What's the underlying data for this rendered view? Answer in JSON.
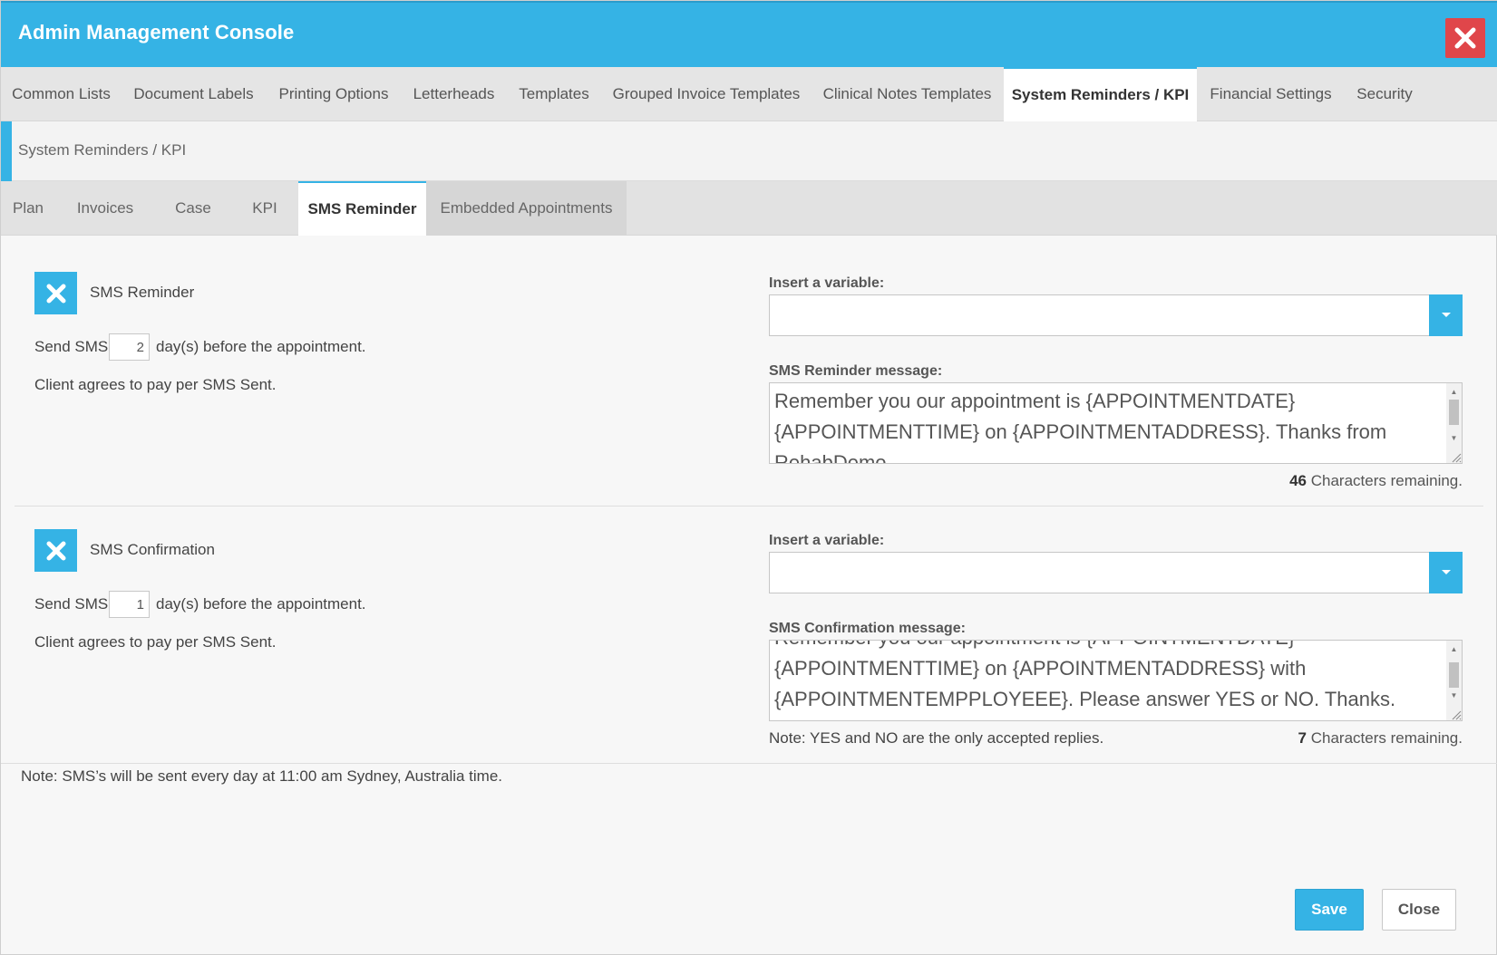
{
  "window": {
    "title": "Admin Management Console",
    "accent_color": "#35b3e5",
    "close_color": "#e0464a"
  },
  "top_tabs": [
    {
      "label": "Common Lists",
      "active": false
    },
    {
      "label": "Document Labels",
      "active": false
    },
    {
      "label": "Printing Options",
      "active": false
    },
    {
      "label": "Letterheads",
      "active": false
    },
    {
      "label": "Templates",
      "active": false
    },
    {
      "label": "Grouped Invoice Templates",
      "active": false
    },
    {
      "label": "Clinical Notes Templates",
      "active": false
    },
    {
      "label": "System Reminders / KPI",
      "active": true
    },
    {
      "label": "Financial Settings",
      "active": false
    },
    {
      "label": "Security",
      "active": false
    }
  ],
  "breadcrumb": "System Reminders / KPI",
  "sub_tabs": [
    {
      "label": "Plan",
      "active": false
    },
    {
      "label": "Invoices",
      "active": false
    },
    {
      "label": "Case",
      "active": false
    },
    {
      "label": "KPI",
      "active": false
    },
    {
      "label": "SMS Reminder",
      "active": true
    },
    {
      "label": "Embedded Appointments",
      "active": false
    }
  ],
  "reminder": {
    "checkbox_label": "SMS Reminder",
    "send_prefix": "Send SMS",
    "days": "2",
    "send_suffix": "day(s) before the appointment.",
    "pay_note": "Client agrees to pay per SMS Sent.",
    "variable_label": "Insert a variable:",
    "message_label": "SMS Reminder message:",
    "message": "Remember you our appointment is {APPOINTMENTDATE} {APPOINTMENTTIME} on {APPOINTMENTADDRESS}. Thanks from RehabDemo",
    "remaining_count": "46",
    "remaining_text": "Characters remaining."
  },
  "confirmation": {
    "checkbox_label": "SMS Confirmation",
    "send_prefix": "Send SMS",
    "days": "1",
    "send_suffix": "day(s) before the appointment.",
    "pay_note": "Client agrees to pay per SMS Sent.",
    "variable_label": "Insert a variable:",
    "message_label": "SMS Confirmation message:",
    "message": "Remember you our appointment is {APPOINTMENTDATE} {APPOINTMENTTIME} on {APPOINTMENTADDRESS} with {APPOINTMENTEMPPLOYEEE}. Please answer YES or NO. Thanks.",
    "reply_note": "Note: YES and NO are the only accepted replies.",
    "remaining_count": "7",
    "remaining_text": "Characters remaining."
  },
  "footer_note": "Note: SMS’s will be sent every day at 11:00 am Sydney, Australia time.",
  "buttons": {
    "save": "Save",
    "close": "Close"
  }
}
